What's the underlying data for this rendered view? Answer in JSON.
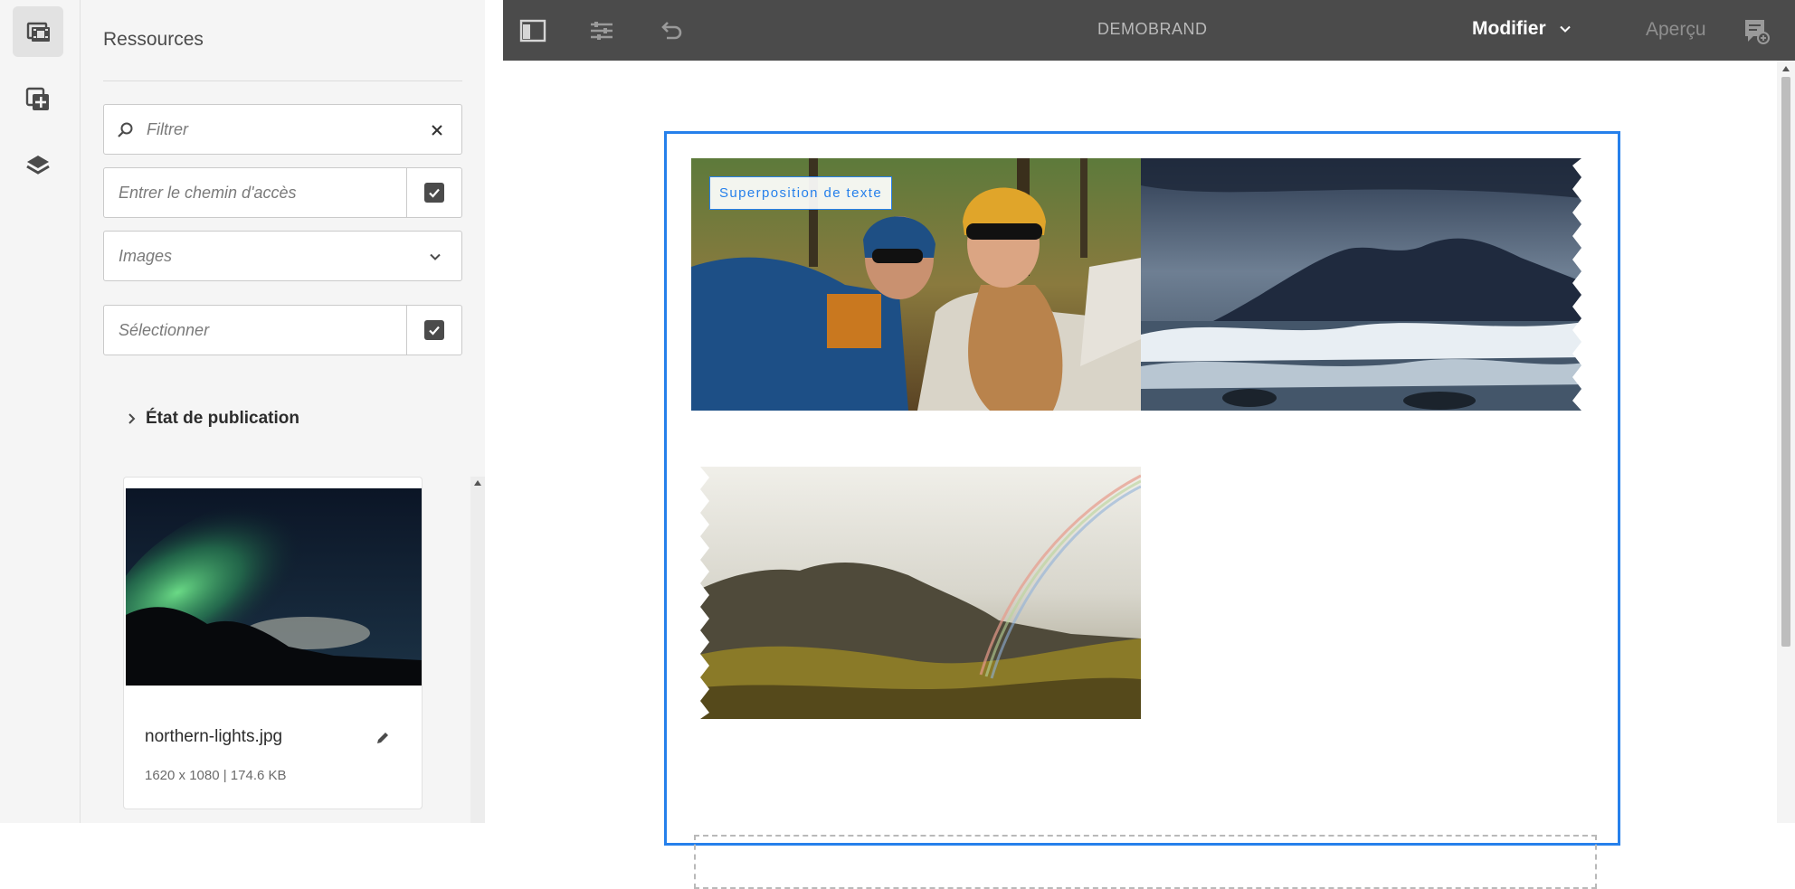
{
  "rail": {
    "items": [
      {
        "name": "assets-finder",
        "icon": "film-image-icon",
        "active": true
      },
      {
        "name": "components",
        "icon": "add-component-icon",
        "active": false
      },
      {
        "name": "content-tree",
        "icon": "layers-icon",
        "active": false
      }
    ]
  },
  "panel": {
    "title": "Ressources",
    "filter_placeholder": "Filtrer",
    "path_placeholder": "Entrer le chemin d'accès",
    "type_value": "Images",
    "select_placeholder": "Sélectionner",
    "publication_status": "État de publication",
    "asset": {
      "name": "northern-lights.jpg",
      "meta": "1620 x 1080 | 174.6 KB"
    }
  },
  "topbar": {
    "brand": "DEMOBRAND",
    "mode": "Modifier",
    "preview": "Aperçu"
  },
  "canvas": {
    "overlay_text": "Superposition de texte",
    "images": [
      {
        "name": "friends-selfie"
      },
      {
        "name": "stormy-sea-mountains"
      },
      {
        "name": "rainbow-mountains"
      }
    ]
  },
  "colors": {
    "accent": "#2680eb",
    "topbar": "#4b4b4b",
    "panel": "#f5f5f5"
  }
}
